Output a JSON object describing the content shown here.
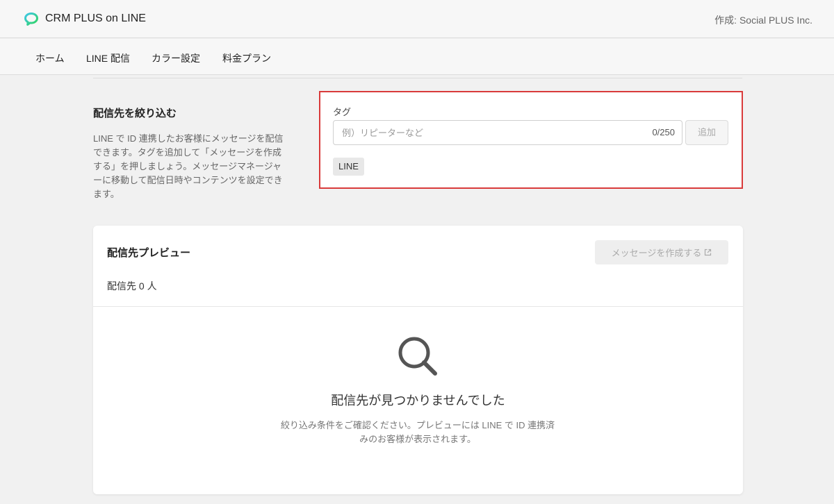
{
  "header": {
    "logo_icon": "chat-bubble-logo-icon",
    "app_title": "CRM PLUS on LINE",
    "credit": "作成: Social PLUS Inc."
  },
  "nav": {
    "items": [
      {
        "label": "ホーム"
      },
      {
        "label": "LINE 配信"
      },
      {
        "label": "カラー設定"
      },
      {
        "label": "料金プラン"
      }
    ]
  },
  "filter": {
    "title": "配信先を絞り込む",
    "description": "LINE で ID 連携したお客様にメッセージを配信できます。タグを追加して「メッセージを作成する」を押しましょう。メッセージマネージャーに移動して配信日時やコンテンツを設定できます。",
    "tag_label": "タグ",
    "tag_placeholder": "例）リピーターなど",
    "tag_value": "",
    "tag_counter": "0/250",
    "add_button": "追加",
    "chips": [
      "LINE"
    ],
    "highlight_color": "#d93a3a"
  },
  "preview": {
    "title": "配信先プレビュー",
    "create_button": "メッセージを作成する",
    "create_button_icon": "external-link-icon",
    "recipient_count": "配信先 0 人",
    "empty_icon": "search-icon",
    "empty_title": "配信先が見つかりませんでした",
    "empty_description": "絞り込み条件をご確認ください。プレビューには LINE で ID 連携済みのお客様が表示されます。"
  }
}
